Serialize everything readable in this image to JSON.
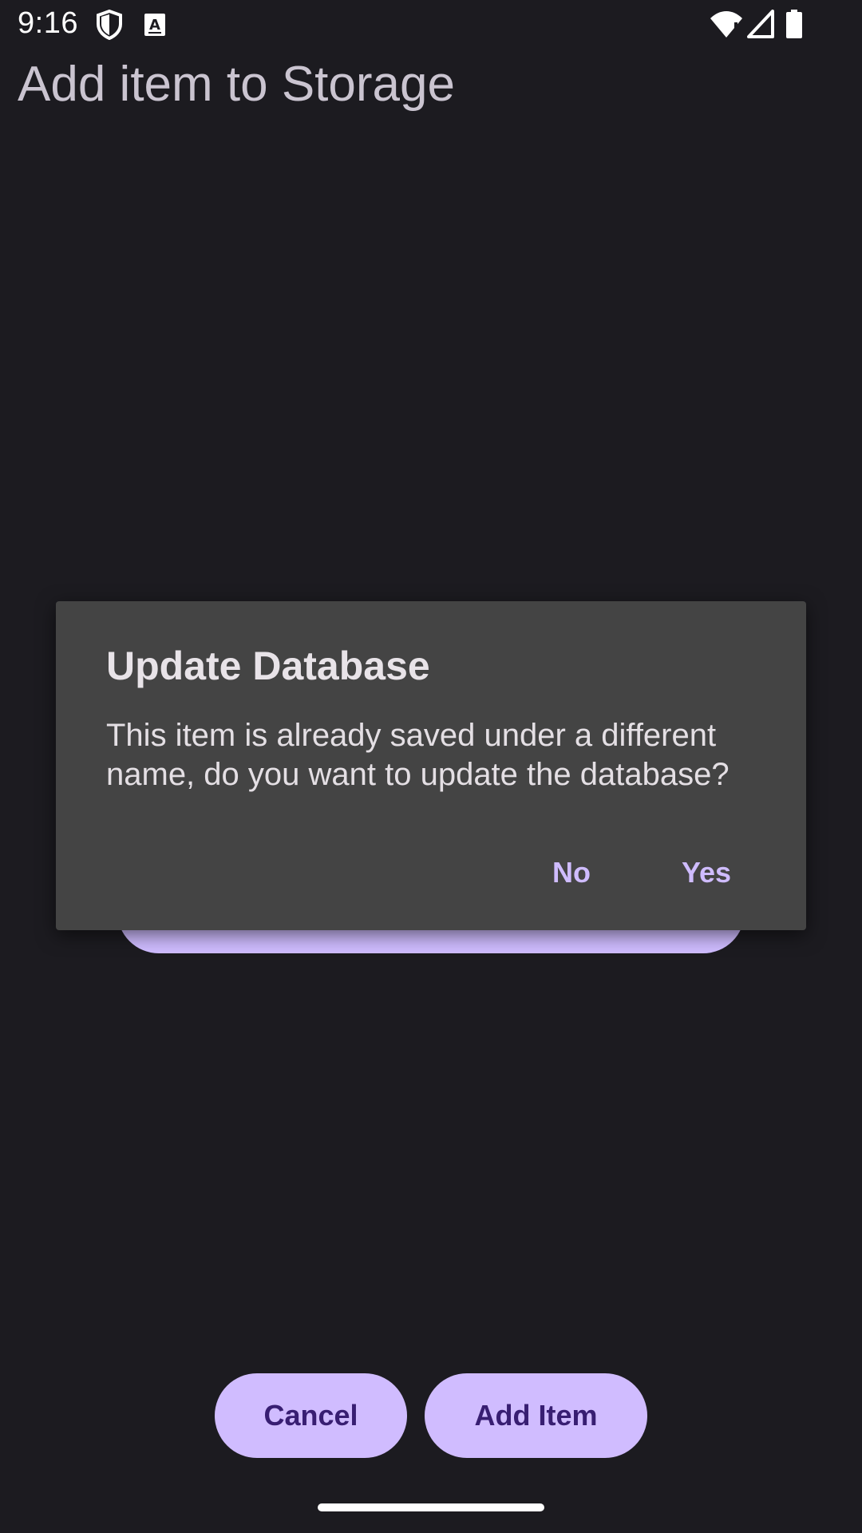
{
  "status_bar": {
    "time": "9:16",
    "icons": [
      "shield-icon",
      "keyboard-a-icon",
      "wifi-icon",
      "signal-icon",
      "battery-icon"
    ]
  },
  "page": {
    "title": "Add item to Storage"
  },
  "dialog": {
    "title": "Update Database",
    "message": "This item is already saved under a different name, do you want to update the database?",
    "no_label": "No",
    "yes_label": "Yes"
  },
  "actions": {
    "cancel_label": "Cancel",
    "add_label": "Add Item"
  },
  "colors": {
    "background": "#1c1b20",
    "accent": "#d0bcff",
    "dialog_bg": "#444444",
    "button_text": "#381e72"
  }
}
